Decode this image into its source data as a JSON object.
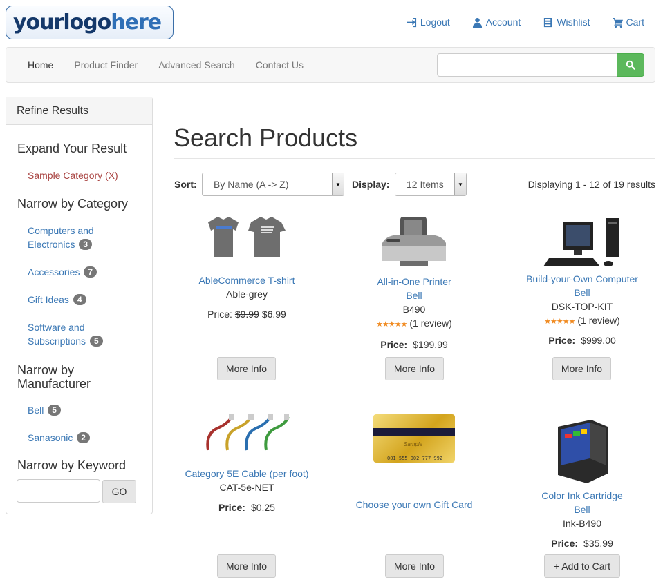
{
  "logo": {
    "part1": "yourlogo",
    "part2": "here"
  },
  "toplinks": [
    {
      "label": "Logout",
      "icon": "logout-icon"
    },
    {
      "label": "Account",
      "icon": "user-icon"
    },
    {
      "label": "Wishlist",
      "icon": "list-icon"
    },
    {
      "label": "Cart",
      "icon": "cart-icon"
    }
  ],
  "nav": [
    "Home",
    "Product Finder",
    "Advanced Search",
    "Contact Us"
  ],
  "search": {
    "placeholder": "",
    "value": ""
  },
  "sidebar": {
    "title": "Refine Results",
    "expand_heading": "Expand Your Result",
    "expand_link": "Sample Category (X)",
    "category_heading": "Narrow by Category",
    "categories": [
      {
        "line1": "Computers and",
        "line2": "Electronics",
        "count": "3"
      },
      {
        "line1": "Accessories",
        "count": "7"
      },
      {
        "line1": "Gift Ideas",
        "count": "4"
      },
      {
        "line1": "Software and",
        "line2": "Subscriptions",
        "count": "5"
      }
    ],
    "manufacturer_heading_1": "Narrow by",
    "manufacturer_heading_2": "Manufacturer",
    "manufacturers": [
      {
        "name": "Bell",
        "count": "5"
      },
      {
        "name": "Sanasonic",
        "count": "2"
      }
    ],
    "keyword_heading": "Narrow by Keyword",
    "go_label": "GO"
  },
  "main": {
    "title": "Search Products",
    "sort_label": "Sort:",
    "sort_value": "By Name (A -> Z)",
    "display_label": "Display:",
    "display_value": "12 Items",
    "results_text": "Displaying 1 - 12 of 19 results",
    "price_label": "Price:"
  },
  "products": [
    {
      "name": "AbleCommerce T-shirt",
      "sku": "Able-grey",
      "price_prefix": "Price:",
      "old_price": "$9.99",
      "price": "$6.99",
      "button": "More Info"
    },
    {
      "name_line1": "All-in-One Printer",
      "name_line2": "Bell",
      "sku": "B490",
      "stars": "★★★★★",
      "reviews": "(1 review)",
      "price": "$199.99",
      "button": "More Info"
    },
    {
      "name_line1": "Build-your-Own Computer",
      "name_line2": "Bell",
      "sku": "DSK-TOP-KIT",
      "stars": "★★★★★",
      "reviews": "(1 review)",
      "price": "$999.00",
      "button": "More Info"
    },
    {
      "name": "Category 5E Cable (per foot)",
      "sku": "CAT-5e-NET",
      "price": "$0.25",
      "button": "More Info"
    },
    {
      "name": "Choose your own Gift Card",
      "card_text": "Sample",
      "card_number": "001 555 002 777 992",
      "button": "More Info"
    },
    {
      "name_line1": "Color Ink Cartridge",
      "name_line2": "Bell",
      "sku": "Ink-B490",
      "price": "$35.99",
      "button": "+ Add to Cart"
    }
  ],
  "colors": {
    "link": "#3b78b5",
    "success": "#5cb85c",
    "badge": "#777777",
    "star": "#f0891e"
  }
}
